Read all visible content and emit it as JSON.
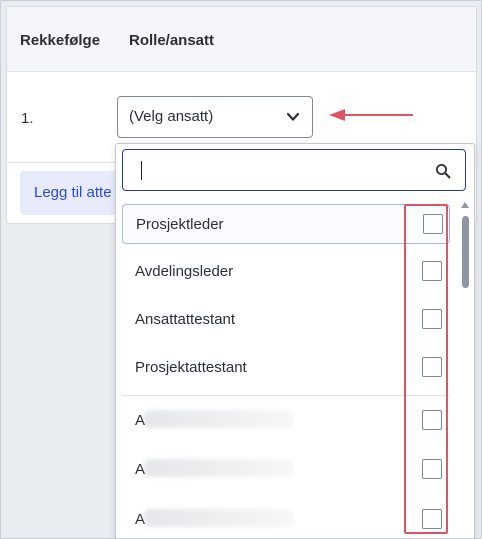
{
  "table": {
    "col_order": "Rekkefølge",
    "col_role": "Rolle/ansatt",
    "row_number": "1.",
    "select_value": "(Velg ansatt)",
    "add_button": "Legg til atte"
  },
  "dropdown": {
    "search_placeholder": "",
    "roles": [
      "Prosjektleder",
      "Avdelingsleder",
      "Ansattattestant",
      "Prosjektattestant"
    ],
    "employees_visible_initial": [
      "A",
      "A",
      "A"
    ]
  },
  "colors": {
    "accent": "#2c4ad6",
    "highlight": "#e05565",
    "header_bg": "#f5f6f9",
    "button_bg": "#e8ebfb"
  }
}
